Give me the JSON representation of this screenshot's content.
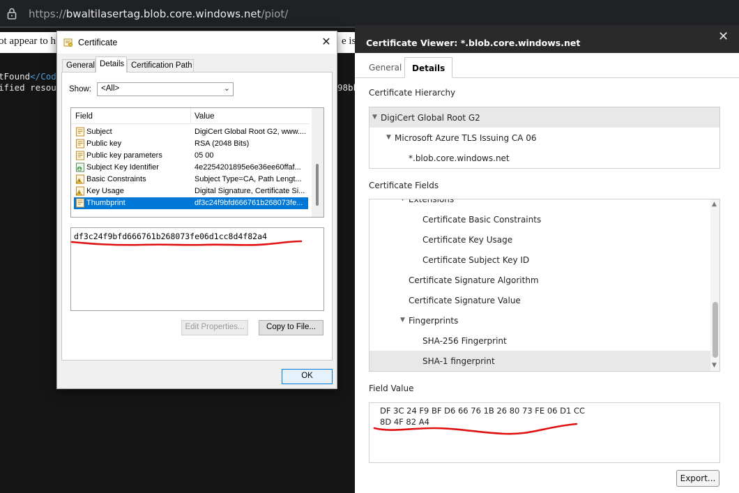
{
  "browser": {
    "url_prefix": "https://",
    "url_host": "bwaltilasertag.blob.core.windows.net",
    "url_path": "/piot/"
  },
  "page": {
    "message_left": "ot appear to h",
    "message_right": "e is",
    "code_line1_text": "tFound",
    "code_line1_tag": "</Code",
    "code_line2": "ified resou",
    "code_line2_right": "98bb"
  },
  "win_dialog": {
    "title": "Certificate",
    "tabs": [
      "General",
      "Details",
      "Certification Path"
    ],
    "show_label": "Show:",
    "show_value": "<All>",
    "columns": {
      "field": "Field",
      "value": "Value"
    },
    "fields": [
      {
        "name": "Subject",
        "value": "DigiCert Global Root G2, www....",
        "icon": "document-icon"
      },
      {
        "name": "Public key",
        "value": "RSA (2048 Bits)",
        "icon": "document-icon"
      },
      {
        "name": "Public key parameters",
        "value": "05 00",
        "icon": "document-icon"
      },
      {
        "name": "Subject Key Identifier",
        "value": "4e2254201895e6e36ee60ffaf...",
        "icon": "download-arrow-icon"
      },
      {
        "name": "Basic Constraints",
        "value": "Subject Type=CA, Path Lengt...",
        "icon": "warning-icon"
      },
      {
        "name": "Key Usage",
        "value": "Digital Signature, Certificate Si...",
        "icon": "warning-icon"
      },
      {
        "name": "Thumbprint",
        "value": "df3c24f9bfd666761b268073fe...",
        "icon": "document-icon"
      }
    ],
    "selected_field": "Thumbprint",
    "field_value": "df3c24f9bfd666761b268073fe06d1cc8d4f82a4",
    "edit_properties": "Edit Properties...",
    "copy_to_file": "Copy to File...",
    "ok": "OK"
  },
  "cert_viewer": {
    "title": "Certificate Viewer: *.blob.core.windows.net",
    "tabs": [
      "General",
      "Details"
    ],
    "active_tab": "Details",
    "hierarchy_label": "Certificate Hierarchy",
    "hierarchy": [
      "DigiCert Global Root G2",
      "Microsoft Azure TLS Issuing CA 06",
      "*.blob.core.windows.net"
    ],
    "fields_label": "Certificate Fields",
    "fields": [
      "Extensions",
      "Certificate Basic Constraints",
      "Certificate Key Usage",
      "Certificate Subject Key ID",
      "Certificate Signature Algorithm",
      "Certificate Signature Value",
      "Fingerprints",
      "SHA-256 Fingerprint",
      "SHA-1 fingerprint"
    ],
    "field_value_label": "Field Value",
    "field_value": "DF 3C 24 F9 BF D6 66 76 1B 26 80 73 FE 06 D1 CC\n8D 4F 82 A4",
    "export": "Export..."
  },
  "colors": {
    "selection": "#0078d7",
    "annotation_red": "#e01010",
    "viewer_header": "#2a2a2a"
  }
}
